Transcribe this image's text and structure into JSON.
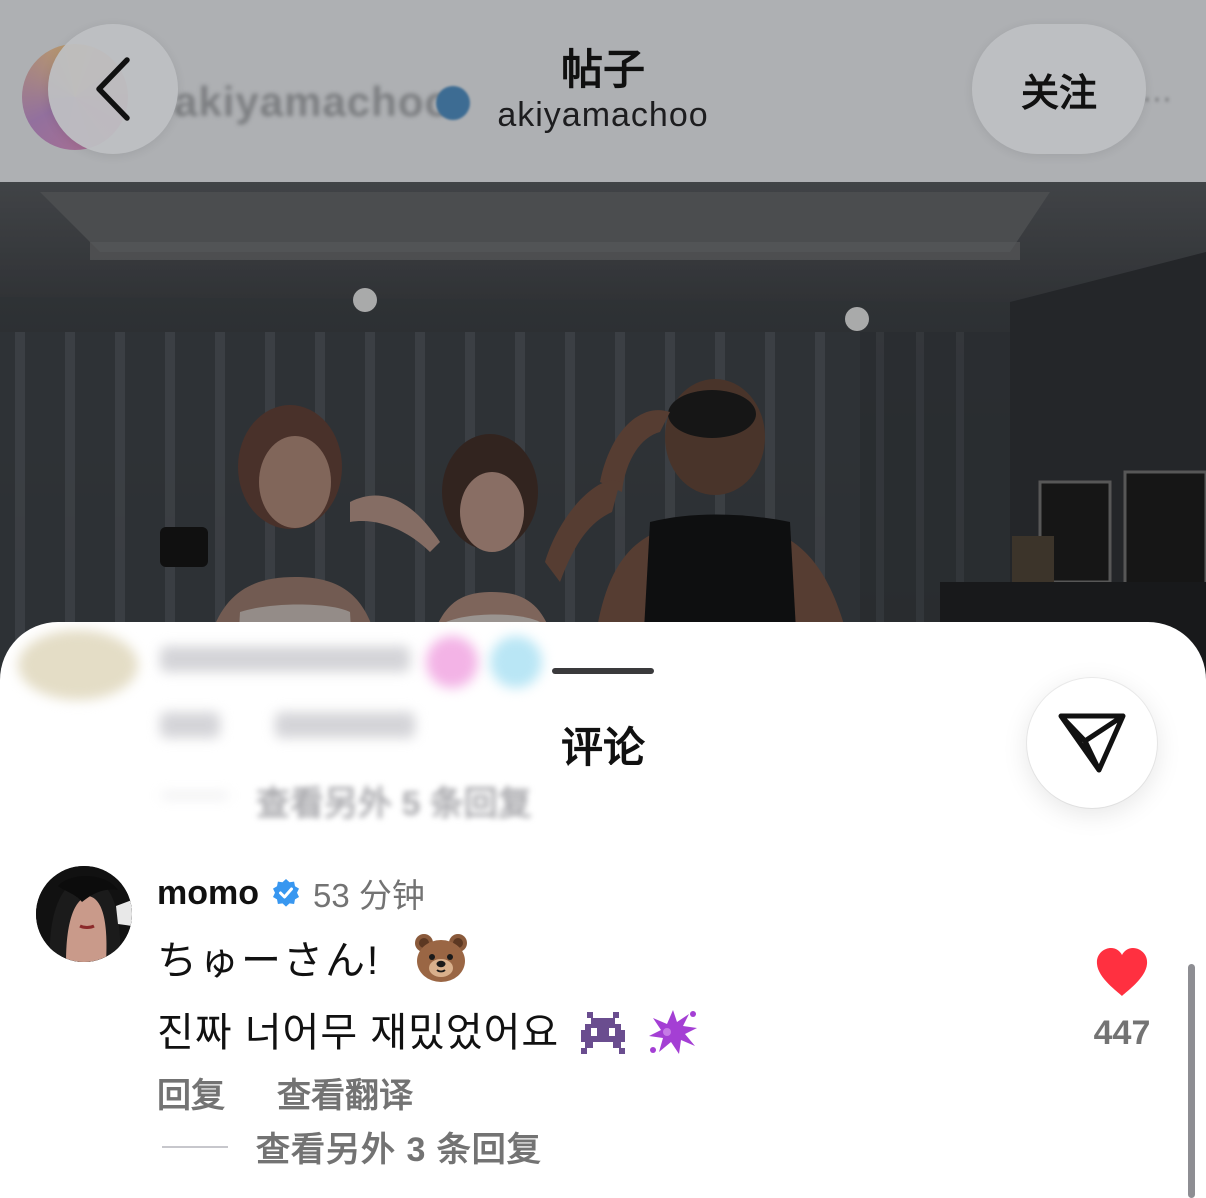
{
  "header": {
    "title": "帖子",
    "subtitle": "akiyamachoo",
    "background_username": "akiyamachoo",
    "follow_label": "关注"
  },
  "sheet": {
    "title": "评论",
    "hidden_view_replies": "查看另外 5 条回复"
  },
  "comment": {
    "username": "momo",
    "verified": true,
    "timestamp": "53 分钟",
    "line1": "ちゅーさん!",
    "line1_emoji": "bear-face",
    "line2": "진짜 너어무 재밌었어요",
    "line2_emojis": [
      "alien-monster",
      "purple-splash"
    ],
    "reply_label": "回复",
    "translate_label": "查看翻译",
    "like_count": "447",
    "liked": true,
    "view_replies_label": "查看另外 3 条回复"
  },
  "colors": {
    "accent_like": "#ff3040",
    "verified_blue": "#3897f0",
    "secondary_text": "#737373"
  },
  "icons": {
    "back": "chevron-left-icon",
    "share": "paper-plane-icon",
    "verified": "verified-badge-icon",
    "like": "heart-icon"
  }
}
